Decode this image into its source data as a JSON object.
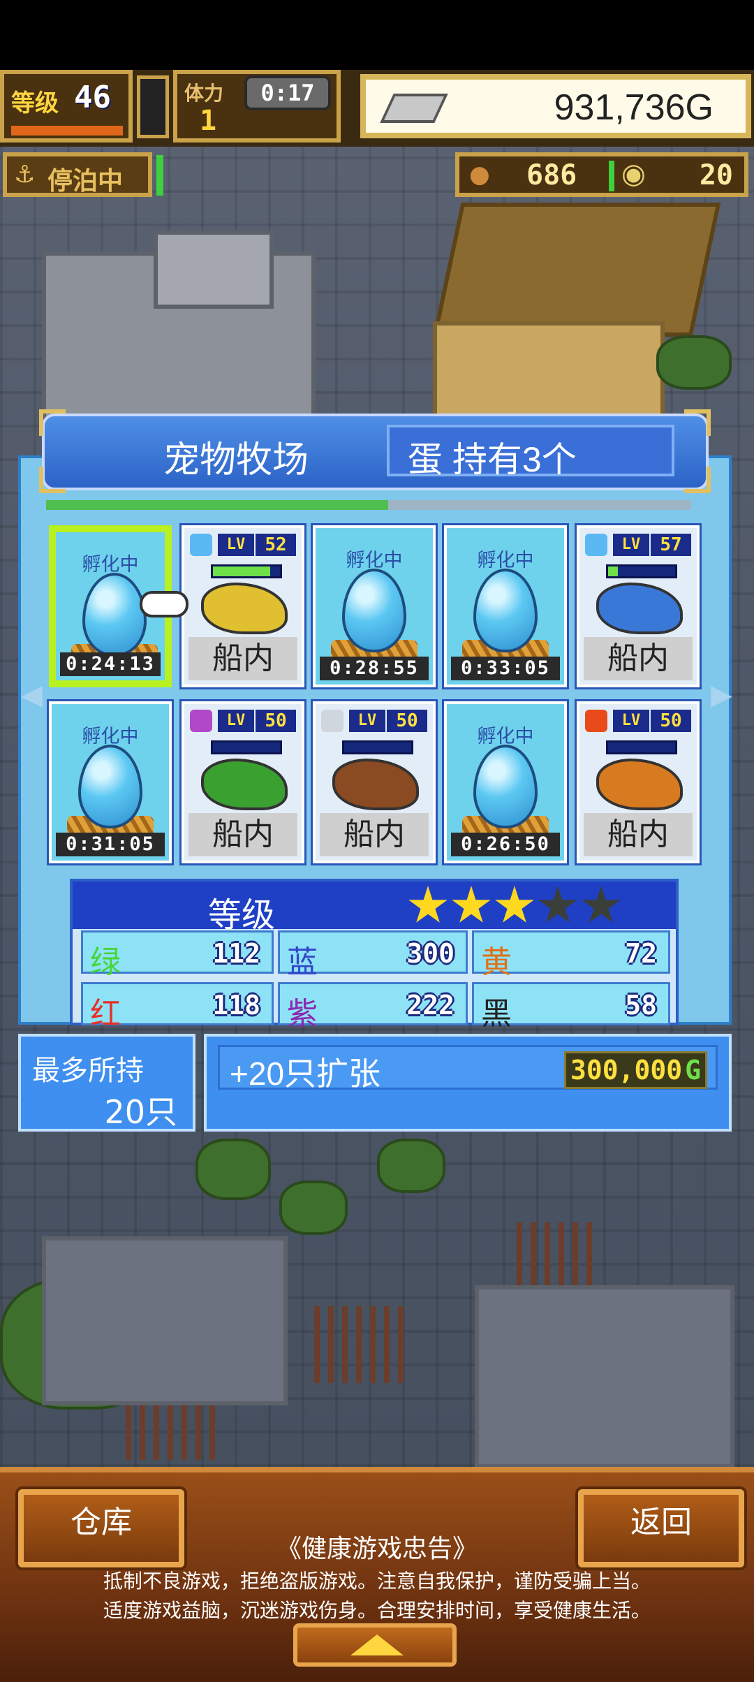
{
  "hud": {
    "level_label": "等级",
    "level_value": "46",
    "stamina_label": "体力",
    "stamina_value": "1",
    "timer": "0:17",
    "gold": "931,736G",
    "status": "停泊中",
    "food": "686",
    "medals": "20"
  },
  "panel": {
    "title": "宠物牧场",
    "eggs_held": "蛋 持有3个",
    "slots": [
      {
        "type": "egg",
        "label": "孵化中",
        "timer": "0:24:13"
      },
      {
        "type": "pet",
        "level_tag": "LV",
        "level": "52",
        "location": "船内",
        "element_color": "#5ab8f2",
        "hp_fraction": 0.85,
        "creature": "yellow-crab-icon",
        "creature_color": "#e0c030"
      },
      {
        "type": "egg",
        "label": "孵化中",
        "timer": "0:28:55"
      },
      {
        "type": "egg",
        "label": "孵化中",
        "timer": "0:33:05"
      },
      {
        "type": "pet",
        "level_tag": "LV",
        "level": "57",
        "location": "船内",
        "element_color": "#5ab8f2",
        "hp_fraction": 0.15,
        "creature": "blue-beast-icon",
        "creature_color": "#3a78d8"
      },
      {
        "type": "egg",
        "label": "孵化中",
        "timer": "0:31:05"
      },
      {
        "type": "pet",
        "level_tag": "LV",
        "level": "50",
        "location": "船内",
        "element_color": "#b048c8",
        "hp_fraction": 0.0,
        "creature": "green-lizard-icon",
        "creature_color": "#3aa030"
      },
      {
        "type": "pet",
        "level_tag": "LV",
        "level": "50",
        "location": "船内",
        "element_color": "#cfd6de",
        "hp_fraction": 0.0,
        "creature": "brown-boar-icon",
        "creature_color": "#8a4a22"
      },
      {
        "type": "egg",
        "label": "孵化中",
        "timer": "0:26:50"
      },
      {
        "type": "pet",
        "level_tag": "LV",
        "level": "50",
        "location": "船内",
        "element_color": "#e84a1a",
        "hp_fraction": 0.0,
        "creature": "orange-dragon-icon",
        "creature_color": "#d87a20"
      }
    ]
  },
  "stats": {
    "header": "等级",
    "stars_filled": 3,
    "stars_total": 5,
    "cells": [
      {
        "name": "绿",
        "value": "112",
        "color": "#46d63a"
      },
      {
        "name": "蓝",
        "value": "300",
        "color": "#3246c8"
      },
      {
        "name": "黄",
        "value": "72",
        "color": "#e07018"
      },
      {
        "name": "红",
        "value": "118",
        "color": "#e8302a"
      },
      {
        "name": "紫",
        "value": "222",
        "color": "#8a2ab0"
      },
      {
        "name": "黑",
        "value": "58",
        "color": "#222222"
      }
    ]
  },
  "capacity": {
    "label": "最多所持",
    "value": "20只",
    "expand_label": "+20只扩张",
    "expand_cost": "300,000",
    "expand_currency": "G"
  },
  "bottom": {
    "warehouse_button": "仓库",
    "back_button": "返回",
    "notice_title": "《健康游戏忠告》",
    "notice_line1": "抵制不良游戏，拒绝盗版游戏。注意自我保护，谨防受骗上当。",
    "notice_line2": "适度游戏益脑，沉迷游戏伤身。合理安排时间，享受健康生活。"
  }
}
